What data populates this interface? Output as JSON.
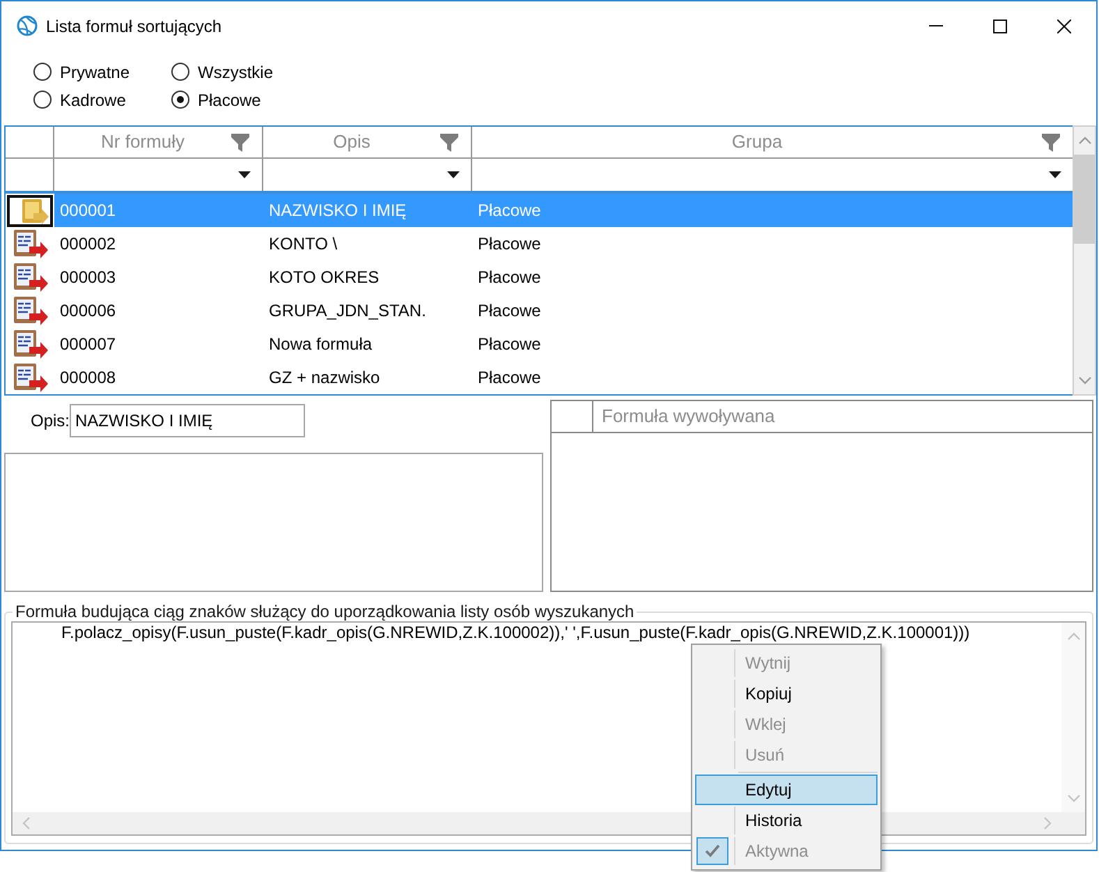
{
  "window": {
    "title": "Lista formuł sortujących"
  },
  "filters": [
    {
      "label": "Prywatne",
      "selected": false
    },
    {
      "label": "Wszystkie",
      "selected": false
    },
    {
      "label": "Kadrowe",
      "selected": false
    },
    {
      "label": "Płacowe",
      "selected": true
    }
  ],
  "grid": {
    "columns": [
      {
        "label": "Nr formuły"
      },
      {
        "label": "Opis"
      },
      {
        "label": "Grupa"
      }
    ],
    "rows": [
      {
        "number": "000001",
        "description": "NAZWISKO I IMIĘ",
        "group": "Płacowe",
        "selected": true
      },
      {
        "number": "000002",
        "description": "KONTO \\",
        "group": "Płacowe",
        "selected": false
      },
      {
        "number": "000003",
        "description": "KOTO OKRES",
        "group": "Płacowe",
        "selected": false
      },
      {
        "number": "000006",
        "description": "GRUPA_JDN_STAN.",
        "group": "Płacowe",
        "selected": false
      },
      {
        "number": "000007",
        "description": "Nowa formuła",
        "group": "Płacowe",
        "selected": false
      },
      {
        "number": "000008",
        "description": "GZ + nazwisko",
        "group": "Płacowe",
        "selected": false
      }
    ]
  },
  "details": {
    "label": "Opis:",
    "value": "NAZWISKO I IMIĘ"
  },
  "called_formulas": {
    "columns": [
      {
        "label": "Formuła wywoływana"
      }
    ]
  },
  "formula": {
    "title": "Formuła budująca ciąg znaków służący do uporządkowania listy osób wyszukanych",
    "text": "F.polacz_opisy(F.usun_puste(F.kadr_opis(G.NREWID,Z.K.100002)),' ',F.usun_puste(F.kadr_opis(G.NREWID,Z.K.100001)))"
  },
  "context_menu": {
    "items": [
      {
        "kind": "item",
        "label": "Wytnij",
        "disabled": true,
        "highlighted": false,
        "checked": false
      },
      {
        "kind": "item",
        "label": "Kopiuj",
        "disabled": false,
        "highlighted": false,
        "checked": false
      },
      {
        "kind": "item",
        "label": "Wklej",
        "disabled": true,
        "highlighted": false,
        "checked": false
      },
      {
        "kind": "item",
        "label": "Usuń",
        "disabled": true,
        "highlighted": false,
        "checked": false
      },
      {
        "kind": "separator"
      },
      {
        "kind": "item",
        "label": "Edytuj",
        "disabled": false,
        "highlighted": true,
        "checked": false
      },
      {
        "kind": "item",
        "label": "Historia",
        "disabled": false,
        "highlighted": false,
        "checked": false
      },
      {
        "kind": "item",
        "label": "Aktywna",
        "disabled": true,
        "highlighted": false,
        "checked": true
      }
    ]
  }
}
